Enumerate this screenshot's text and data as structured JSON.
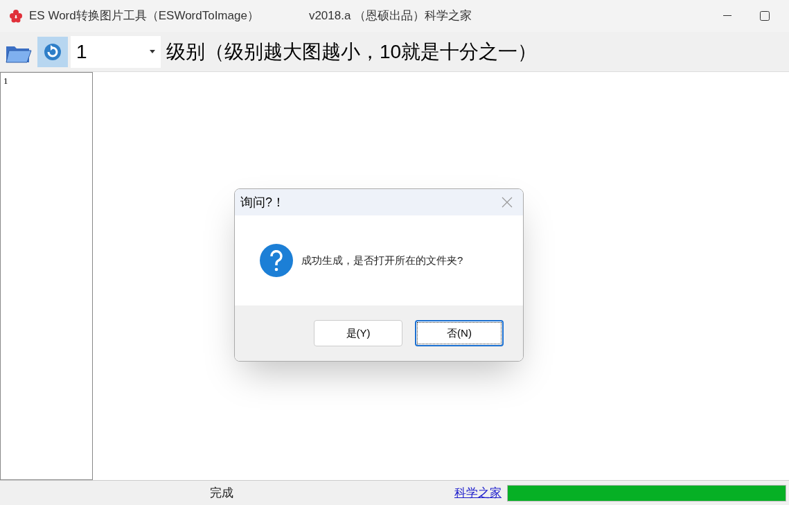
{
  "window": {
    "title": "ES Word转换图片工具（ESWordToImage）",
    "version": "v2018.a （恩硕出品）科学之家"
  },
  "toolbar": {
    "level_value": "1",
    "level_label": "级别（级别越大图越小，10就是十分之一）"
  },
  "page_list": {
    "items": [
      "1"
    ]
  },
  "dialog": {
    "title": "询问?！",
    "message": "成功生成，是否打开所在的文件夹?",
    "buttons": [
      {
        "label": "是(Y)",
        "focused": false
      },
      {
        "label": "否(N)",
        "focused": true
      }
    ]
  },
  "status_bar": {
    "status": "完成",
    "link": "科学之家",
    "progress": {
      "level": 1
    }
  }
}
